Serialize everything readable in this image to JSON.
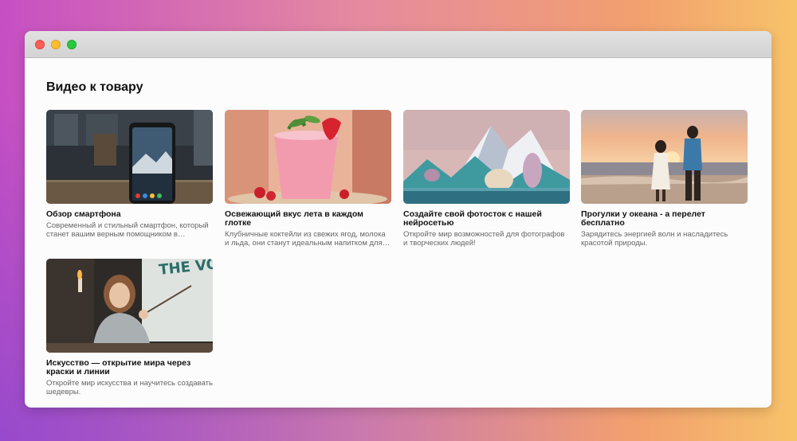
{
  "section": {
    "title": "Видео к товару"
  },
  "videos": [
    {
      "title": "Обзор смартфона",
      "description": "Современный и стильный смартфон, который станет вашим верным помощником в повседневной жизни."
    },
    {
      "title": "Освежающий вкус лета в каждом глотке",
      "description": "Клубничные коктейли из свежих ягод, молока и льда, они станут идеальным напитком для жаркого дня."
    },
    {
      "title": "Создайте свой фотосток с нашей нейросетью",
      "description": "Откройте мир возможностей для фотографов и творческих людей!"
    },
    {
      "title": "Прогулки у океана - а перелет бесплатно",
      "description": "Зарядитесь энергией волн и насладитесь красотой природы."
    },
    {
      "title": "Искусство — открытие мира через краски и линии",
      "description": "Откройте мир искусства и научитесь создавать шедевры."
    }
  ],
  "thumbnails": {
    "painting_wall_text": "THE VOICES"
  }
}
